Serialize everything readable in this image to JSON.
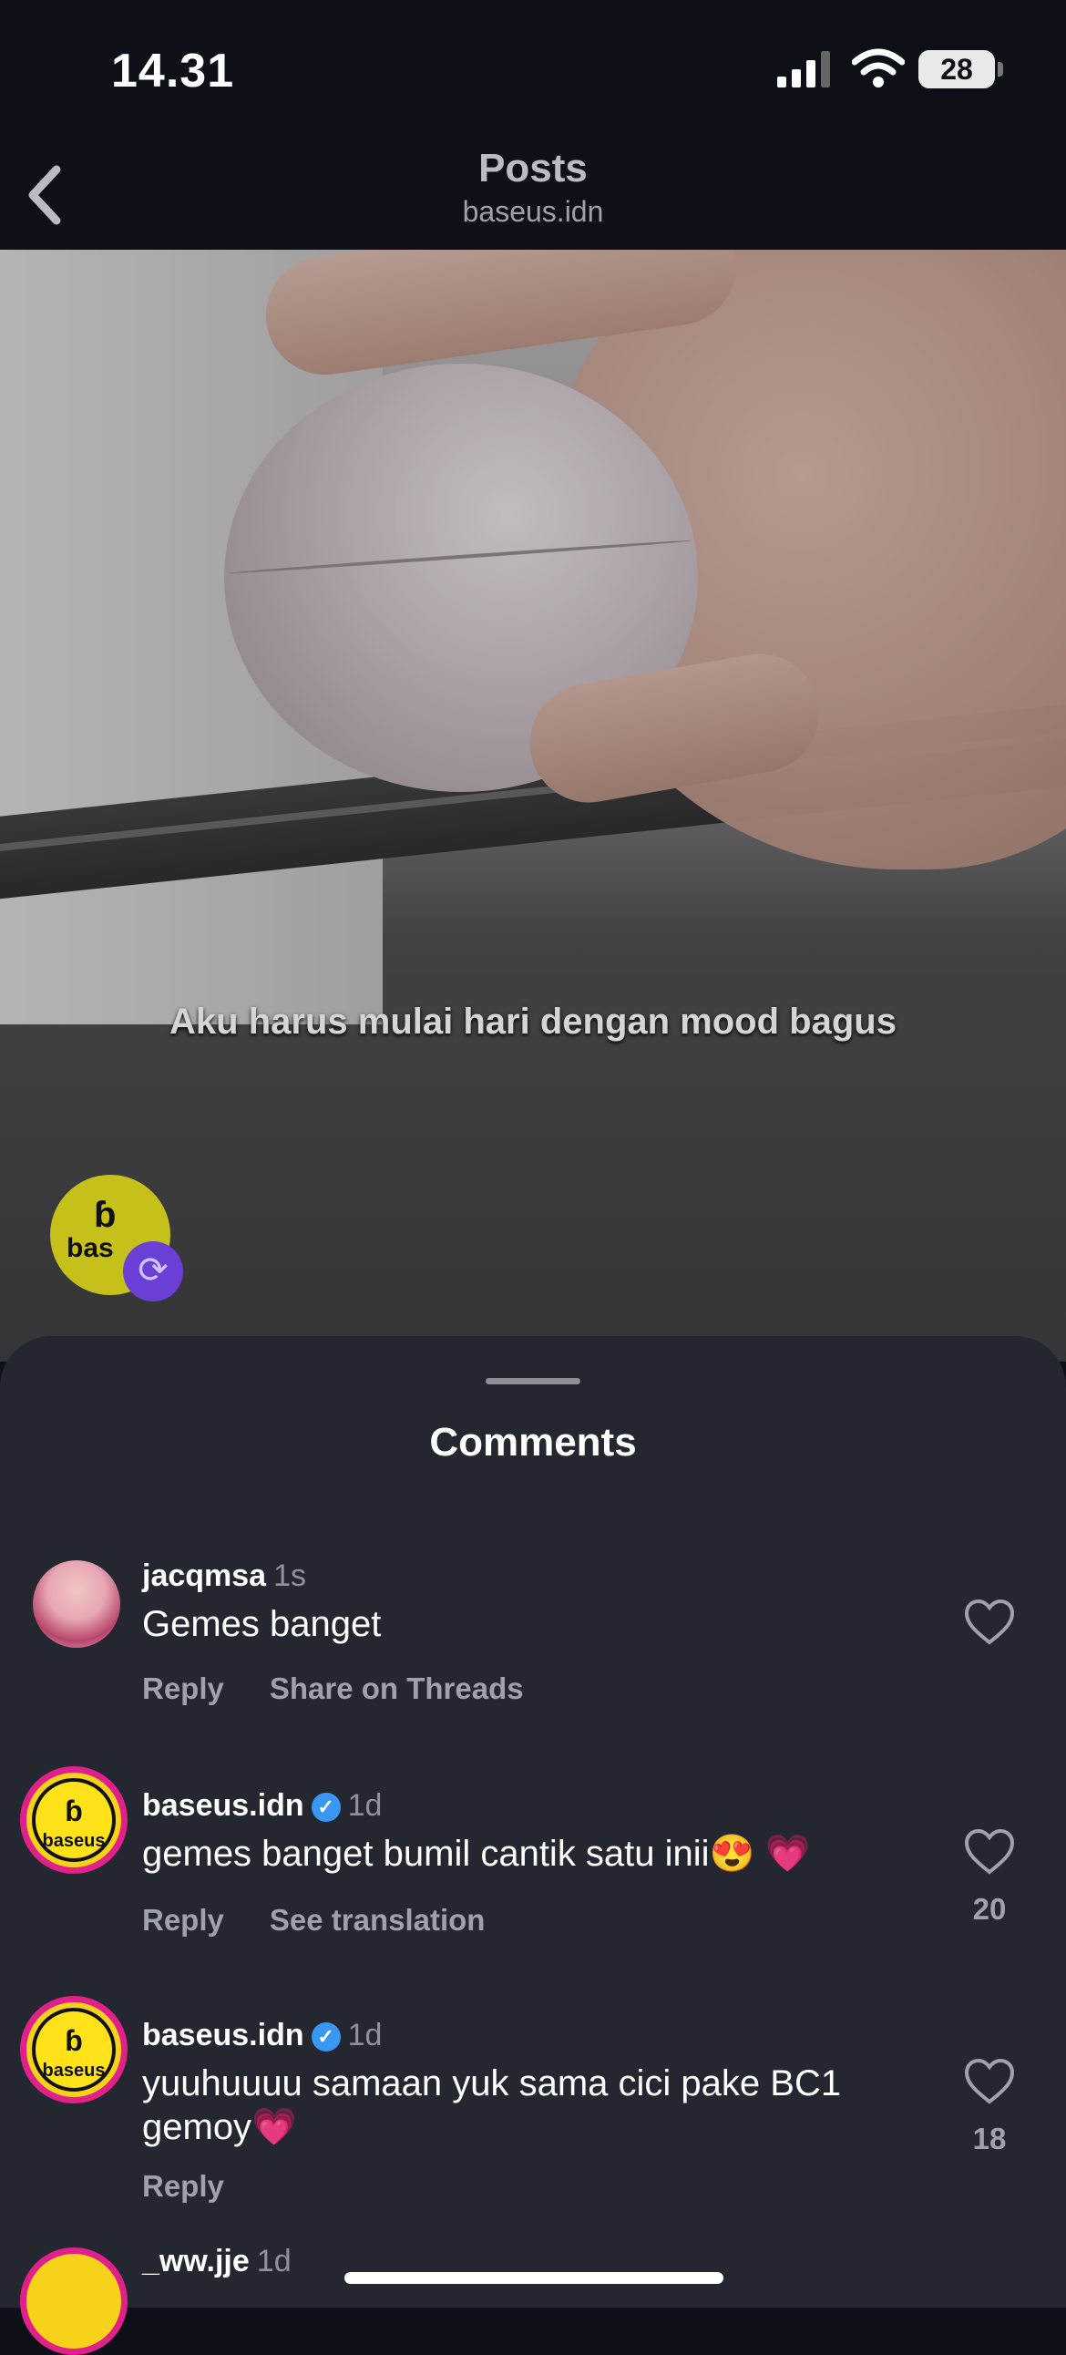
{
  "status_bar": {
    "time": "14.31",
    "battery": "28"
  },
  "header": {
    "title": "Posts",
    "subtitle": "baseus.idn"
  },
  "post": {
    "caption": "Aku harus mulai hari dengan mood bagus",
    "avatar_text": "bas"
  },
  "comments_sheet": {
    "title": "Comments",
    "comments": [
      {
        "user": "jacqmsa",
        "time": "1s",
        "text": "Gemes banget",
        "actions": [
          "Reply",
          "Share on Threads"
        ],
        "likes": ""
      },
      {
        "user": "baseus.idn",
        "time": "1d",
        "text": "gemes banget bumil cantik satu inii😍 💗",
        "actions": [
          "Reply",
          "See translation"
        ],
        "likes": "20"
      },
      {
        "user": "baseus.idn",
        "time": "1d",
        "text": "yuuhuuuu samaan yuk sama cici pake BC1 gemoy💗",
        "actions": [
          "Reply"
        ],
        "likes": "18"
      },
      {
        "user": "_ww.jje",
        "time": "1d"
      }
    ]
  },
  "avatar_brand": "baseus",
  "colors": {
    "background": "#0d1117",
    "sheet": "#252730",
    "verified": "#3897f0",
    "ring": "#e0218a"
  }
}
